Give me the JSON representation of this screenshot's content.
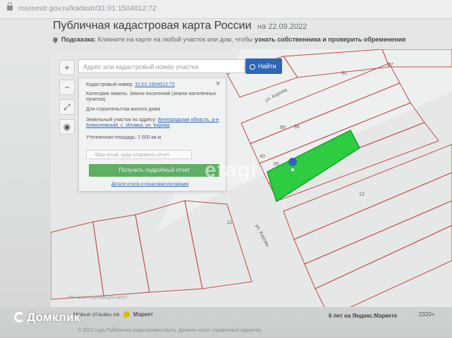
{
  "browser": {
    "url": "rosreestr.gov.ru/kadastr/31:01:1504012:72"
  },
  "page": {
    "title": "Публичная кадастровая карта России",
    "date_prefix": "на",
    "date": "22.09.2022",
    "hint_label": "Подсказка:",
    "hint_text": "Кликните на карте на любой участок или дом, чтобы",
    "hint_bold": "узнать собственника и проверить обременения"
  },
  "search": {
    "placeholder": "Адрес или кадастровый номер участка",
    "button_label": "Найти"
  },
  "toolbar": {
    "zoom_in": "+",
    "zoom_out": "−",
    "fullscreen": "⤢",
    "layers": "◉"
  },
  "card": {
    "cadastral_label": "Кадастровый номер:",
    "cadastral_number": "31:01:1504012:72",
    "category_label": "Категория земель:",
    "category_value": "Земли поселений (земли населенных пунктов)",
    "usage_value": "Для строительства жилого дома",
    "address_label": "Земельный участок по адресу:",
    "address_value": "Белгородская область, р-н Алексеевский, с. Иловка, ул. Кирова",
    "area_label": "Уточненная площадь:",
    "area_value": "1 500 кв.м.",
    "email_placeholder": "Ваш email, куда отправить отчет",
    "report_button": "Получить подробный отчет",
    "details_link": "Детали отчета и пошаговая инструкция"
  },
  "map": {
    "labels": {
      "street_top": "ул. Кирова",
      "street_mid": "ул. Кирова",
      "n91": "91",
      "n97": "97",
      "n89": "89",
      "n86": "86",
      "n95": "95",
      "n40": "40",
      "n12": "12",
      "n11": "11"
    },
    "highlight_color": "#2ecc40"
  },
  "watermark": "etagi",
  "footer": {
    "map_note": "Не нашли подходящую карту?",
    "reviews_label": "Новые отзывы на",
    "market_name": "Маркет",
    "age_text": "6 лет на Яндекс.Маркете",
    "count": "2320+",
    "note": "© 2022 года Публичная кадастровая карта. Данные носят справочный характер"
  },
  "brand": {
    "name": "Домклик"
  }
}
